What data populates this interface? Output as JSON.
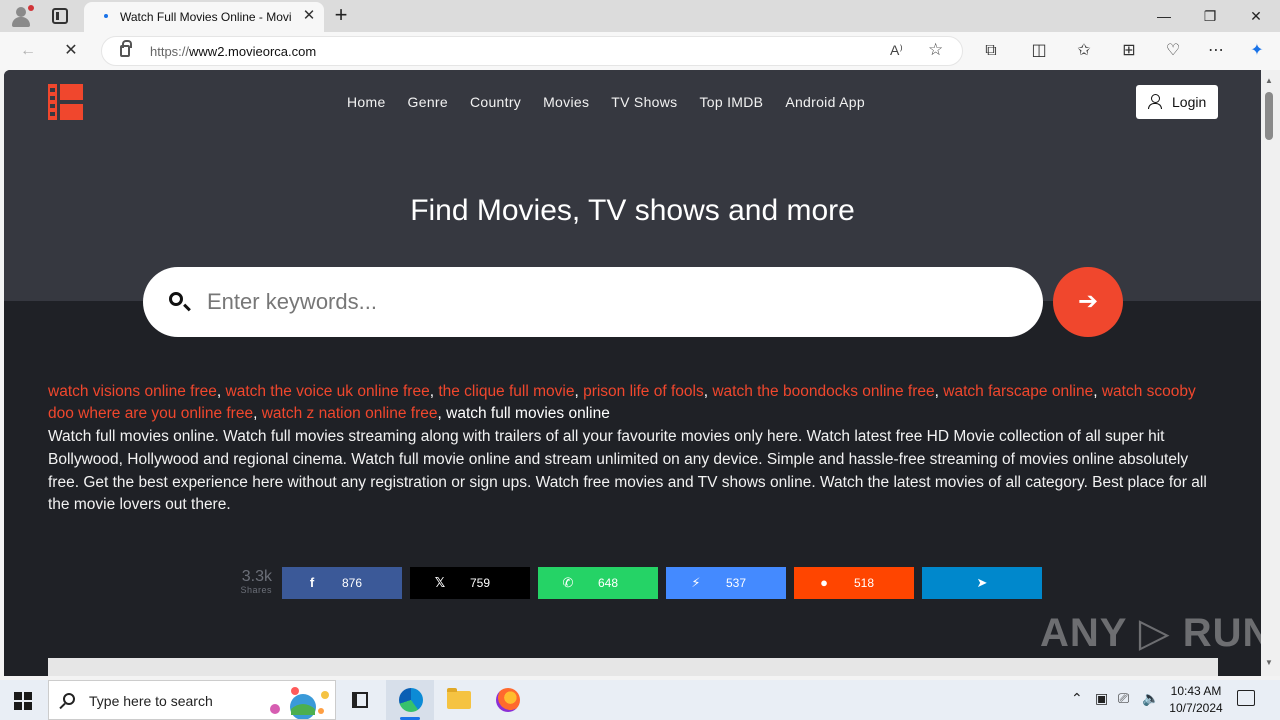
{
  "browser": {
    "tab_title": "Watch Full Movies Online - Movi",
    "tab_close": "✕",
    "new_tab": "+",
    "url_host_prefix": "https://",
    "url_rest": "www2.movieorca.com",
    "read_aloud": "A⁾",
    "window": {
      "minimize": "—",
      "restore": "❐",
      "close": "✕"
    }
  },
  "site": {
    "nav": [
      "Home",
      "Genre",
      "Country",
      "Movies",
      "TV Shows",
      "Top IMDB",
      "Android App"
    ],
    "login_label": "Login",
    "headline": "Find Movies, TV shows and more",
    "search_placeholder": "Enter keywords...",
    "go_arrow": "➔",
    "tag_links": [
      "watch visions online free",
      "watch the voice uk online free",
      "the clique full movie",
      "prison life of fools",
      "watch the boondocks online free",
      "watch farscape online",
      "watch scooby doo where are you online free",
      "watch z nation online free"
    ],
    "tag_plain": "watch full movies online",
    "description": "Watch full movies online. Watch full movies streaming along with trailers of all your favourite movies only here. Watch latest free HD Movie collection of all super hit Bollywood, Hollywood and regional cinema. Watch full movie online and stream unlimited on any device. Simple and hassle-free streaming of movies online absolutely free. Get the best experience here without any registration or sign ups. Watch free movies and TV shows online. Watch the latest movies of all category. Best place for all the movie lovers out there.",
    "share_total": "3.3k",
    "share_label": "Shares",
    "share_buttons": [
      {
        "icon": "facebook-icon",
        "glyph": "f",
        "count": "876",
        "color": "#3b5998"
      },
      {
        "icon": "x-icon",
        "glyph": "𝕏",
        "count": "759",
        "color": "#000000"
      },
      {
        "icon": "whatsapp-icon",
        "glyph": "✆",
        "count": "648",
        "color": "#25d366"
      },
      {
        "icon": "messenger-icon",
        "glyph": "⚡",
        "count": "537",
        "color": "#448aff"
      },
      {
        "icon": "reddit-icon",
        "glyph": "●",
        "count": "518",
        "color": "#ff4500"
      },
      {
        "icon": "telegram-icon",
        "glyph": "➤",
        "count": "",
        "color": "#0088cc"
      }
    ]
  },
  "watermark": "ANY ▷ RUN",
  "taskbar": {
    "search_placeholder": "Type here to search",
    "time": "10:43 AM",
    "date": "10/7/2024"
  }
}
